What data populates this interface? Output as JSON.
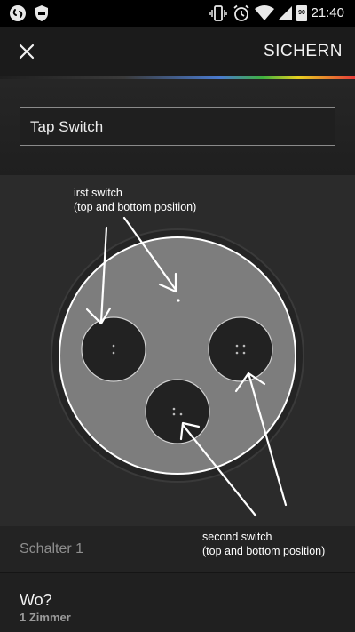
{
  "status_bar": {
    "time": "21:40",
    "battery_level": "90",
    "icons": [
      "shazam-icon",
      "shield-icon",
      "vibrate-icon",
      "alarm-icon",
      "wifi-icon",
      "signal-icon",
      "battery-icon"
    ]
  },
  "app_bar": {
    "close_icon": "close-icon",
    "save_label": "SICHERN"
  },
  "name_field": {
    "value": "Tap Switch"
  },
  "annotations": {
    "first_switch": "irst switch\n(top and bottom position)",
    "second_switch": "second switch\n(top and bottom position)"
  },
  "button_row": {
    "label": "Schalter 1"
  },
  "where_row": {
    "title": "Wo?",
    "subtitle": "1 Zimmer"
  },
  "colors": {
    "background": "#1a1a1a",
    "illustration_bg": "#2b2b2b",
    "device_face": "#7a7a7a",
    "accent_gradient": [
      "#4a7bd0",
      "#3fb23f",
      "#e8d020",
      "#e83a3a"
    ]
  }
}
